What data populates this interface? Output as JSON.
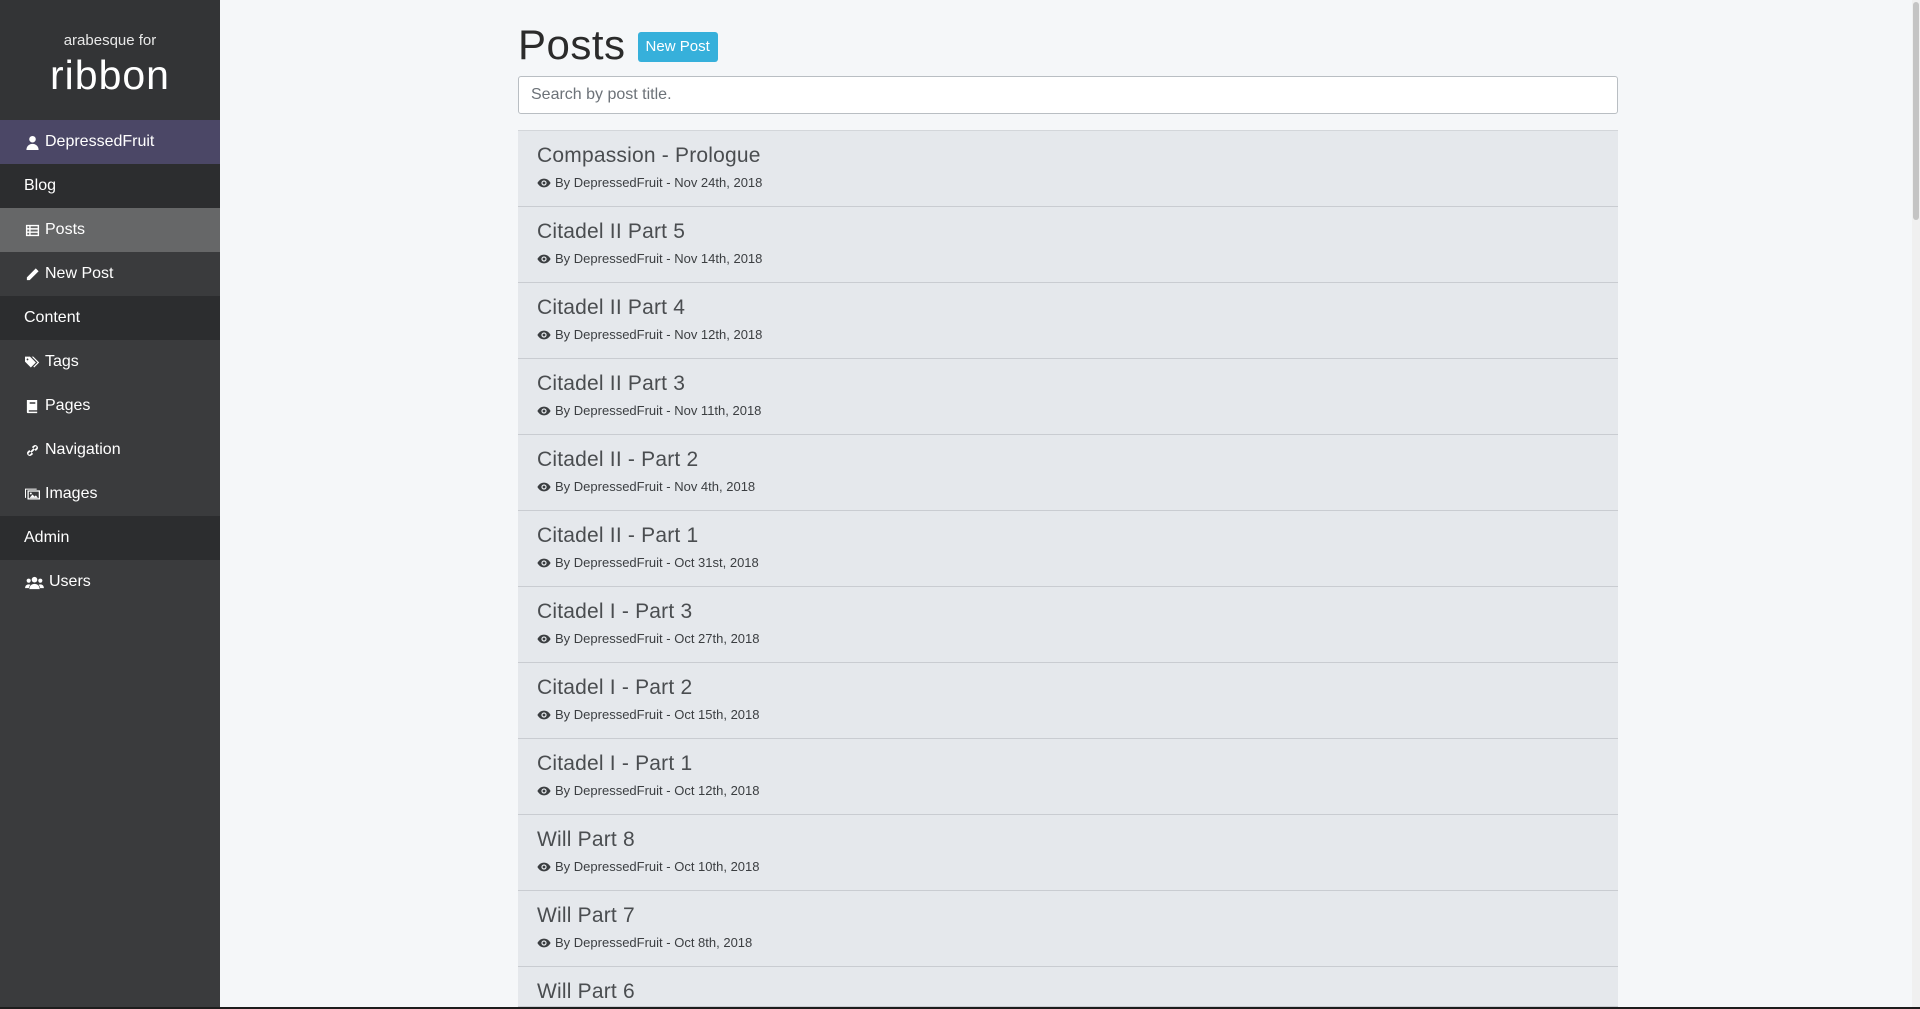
{
  "brand": {
    "subtitle": "arabesque for",
    "name": "ribbon"
  },
  "sidebar": {
    "user": {
      "label": "DepressedFruit",
      "icon": "user-icon"
    },
    "items": [
      {
        "label": "Blog",
        "type": "section"
      },
      {
        "label": "Posts",
        "icon": "table-list-icon",
        "active": true
      },
      {
        "label": "New Post",
        "icon": "pencil-icon"
      },
      {
        "label": "Content",
        "type": "section"
      },
      {
        "label": "Tags",
        "icon": "tags-icon"
      },
      {
        "label": "Pages",
        "icon": "book-icon"
      },
      {
        "label": "Navigation",
        "icon": "link-icon"
      },
      {
        "label": "Images",
        "icon": "images-icon"
      },
      {
        "label": "Admin",
        "type": "section"
      },
      {
        "label": "Users",
        "icon": "users-icon"
      }
    ]
  },
  "main": {
    "title": "Posts",
    "new_post_label": "New Post",
    "search_placeholder": "Search by post title.",
    "posts": [
      {
        "title": "Compassion - Prologue",
        "meta": "By DepressedFruit - Nov 24th, 2018"
      },
      {
        "title": "Citadel II Part 5",
        "meta": "By DepressedFruit - Nov 14th, 2018"
      },
      {
        "title": "Citadel II Part 4",
        "meta": "By DepressedFruit - Nov 12th, 2018"
      },
      {
        "title": "Citadel II Part 3",
        "meta": "By DepressedFruit - Nov 11th, 2018"
      },
      {
        "title": "Citadel II - Part 2",
        "meta": "By DepressedFruit - Nov 4th, 2018"
      },
      {
        "title": "Citadel II - Part 1",
        "meta": "By DepressedFruit - Oct 31st, 2018"
      },
      {
        "title": "Citadel I - Part 3",
        "meta": "By DepressedFruit - Oct 27th, 2018"
      },
      {
        "title": "Citadel I - Part 2",
        "meta": "By DepressedFruit - Oct 15th, 2018"
      },
      {
        "title": "Citadel I - Part 1",
        "meta": "By DepressedFruit - Oct 12th, 2018"
      },
      {
        "title": "Will Part 8",
        "meta": "By DepressedFruit - Oct 10th, 2018"
      },
      {
        "title": "Will Part 7",
        "meta": "By DepressedFruit - Oct 8th, 2018"
      },
      {
        "title": "Will Part 6"
      }
    ]
  },
  "colors": {
    "sidebar_bg": "#3a3b3d",
    "user_bg": "#4b4766",
    "section_bg": "#2c2d2f",
    "active_bg": "#666768",
    "accent": "#36b0db",
    "post_bg": "#e5e8ec"
  }
}
